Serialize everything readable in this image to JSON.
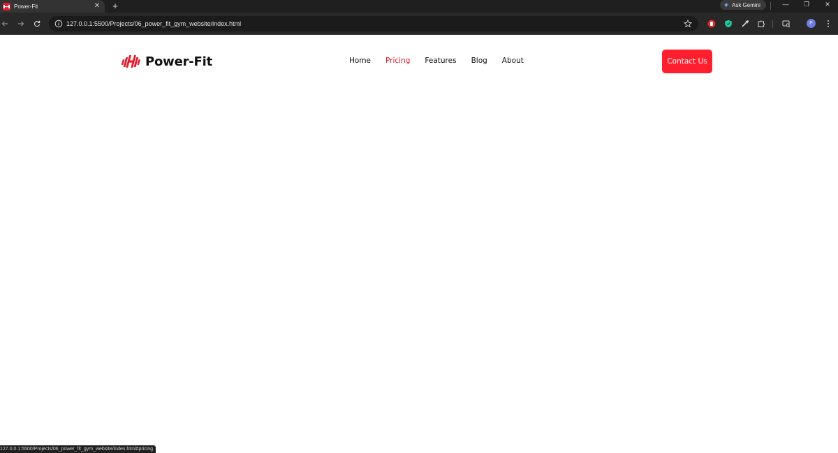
{
  "browser": {
    "tab_title": "Power-Fit",
    "new_tab_label": "+",
    "close_tab_label": "✕",
    "gemini_label": "Ask Gemini",
    "url": "127.0.0.1:5500/Projects/06_power_fit_gym_website/index.html",
    "status_url": "127.0.0.1:5500/Projects/06_power_fit_gym_website/index.html#pricing",
    "profile_initial": "P",
    "window_controls": {
      "minimize": "—",
      "restore": "❐",
      "close": "✕"
    },
    "icons": [
      "back-arrow-icon",
      "forward-arrow-icon",
      "reload-icon",
      "site-info-icon",
      "bookmark-star-icon",
      "extension-shield-icon",
      "extension-vpn-icon",
      "extension-dropper-icon",
      "extensions-puzzle-icon",
      "tab-search-icon",
      "more-menu-icon"
    ]
  },
  "site": {
    "brand": "Power-Fit",
    "nav": [
      {
        "label": "Home",
        "active": false
      },
      {
        "label": "Pricing",
        "active": true
      },
      {
        "label": "Features",
        "active": false
      },
      {
        "label": "Blog",
        "active": false
      },
      {
        "label": "About",
        "active": false
      }
    ],
    "cta_label": "Contact Us"
  },
  "colors": {
    "accent": "#ff1f2e",
    "active_link": "#e31b2d",
    "text": "#111111",
    "chrome_dark": "#1f1f1f"
  }
}
